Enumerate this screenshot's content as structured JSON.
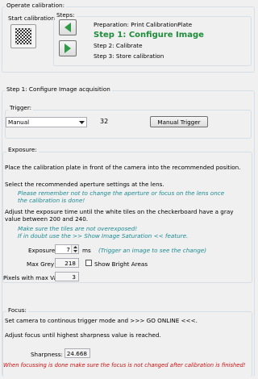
{
  "operate": {
    "title": "Operate calibration:",
    "start_label": "Start calibration",
    "steps_label": "Steps:",
    "preparation": "Preparation: Print CalibrationPlate",
    "step1": "Step 1: Configure Image",
    "step2": "Step 2: Calibrate",
    "step3": "Step 3: Store calibration"
  },
  "step1_section": {
    "title": "Step 1: Configure Image acquisition"
  },
  "trigger": {
    "title": "Trigger:",
    "mode": "Manual",
    "count": "32",
    "button": "Manual Trigger"
  },
  "exposure": {
    "title": "Exposure:",
    "line1": "Place the calibration plate in front of the camera into the recommended position.",
    "line2": "Select the recommended aperture settings at the lens.",
    "note1a": "Please remember not to change the aperture or focus on the lens once",
    "note1b": "the calibration is done!",
    "line3a": "Adjust the exposure time until the white tiles on the checkerboard have a gray",
    "line3b": "value between 200 and 240.",
    "note2a": "Make sure the tiles are not overexposed!",
    "note2b": "If in doubt use the >> Show Image Saturation << feature.",
    "time_label": "Exposure time:",
    "time_value": "7",
    "time_unit": "ms",
    "time_hint": "(Trigger an image to see the change)",
    "maxgrey_label": "Max Grey Value:",
    "maxgrey_value": "218",
    "bright_label": "Show Bright Areas",
    "pixels_label": "Pixels with max Value:",
    "pixels_value": "3"
  },
  "focus": {
    "title": "Focus:",
    "line1": "Set camera to continous trigger mode and >>> GO ONLINE <<<.",
    "line2": "Adjust focus until highest sharpness value is reached.",
    "sharp_label": "Sharpness:",
    "sharp_value": "24.668",
    "warning": "When focussing is done make sure the focus is not changed after calibration is finished!"
  },
  "colors": {
    "step_active": "#1e8c3a",
    "note": "#1b8a92",
    "warning": "#d01010",
    "arrow": "#2e9a48"
  },
  "icons": [
    "checkerboard-icon",
    "arrow-left-icon",
    "arrow-right-icon",
    "spinner-up-icon",
    "spinner-down-icon",
    "dropdown-arrow-icon"
  ]
}
